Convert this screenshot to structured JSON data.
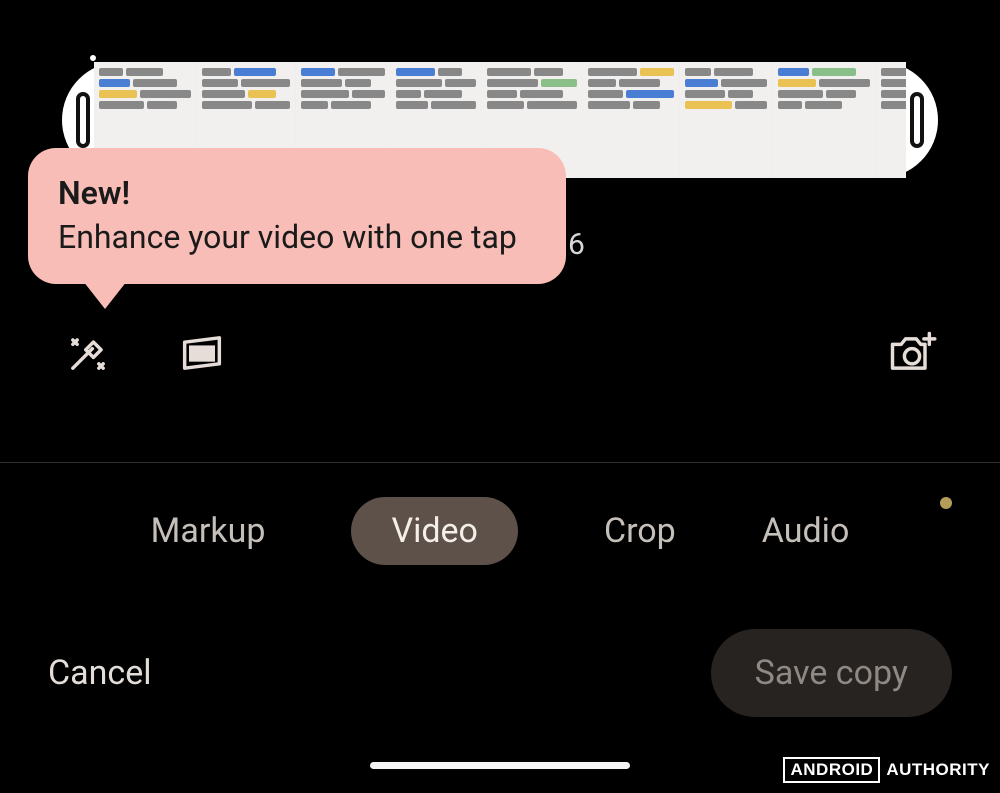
{
  "timeline": {
    "frames": [
      {
        "palette": [
          "d",
          "d",
          "b",
          "d",
          "y",
          "d",
          "d",
          "d"
        ]
      },
      {
        "palette": [
          "d",
          "b",
          "d",
          "d",
          "d",
          "y",
          "d",
          "d"
        ]
      },
      {
        "palette": [
          "b",
          "d",
          "d",
          "d",
          "d",
          "d",
          "d",
          "d"
        ]
      },
      {
        "palette": [
          "b",
          "d",
          "d",
          "d",
          "d",
          "d",
          "d",
          "d"
        ]
      },
      {
        "palette": [
          "d",
          "d",
          "d",
          "g",
          "d",
          "d",
          "d",
          "d"
        ]
      },
      {
        "palette": [
          "d",
          "y",
          "d",
          "d",
          "d",
          "b",
          "d",
          "d"
        ]
      },
      {
        "palette": [
          "d",
          "d",
          "b",
          "d",
          "d",
          "d",
          "y",
          "d"
        ]
      },
      {
        "palette": [
          "b",
          "g",
          "y",
          "d",
          "d",
          "d",
          "d",
          "d"
        ]
      },
      {
        "palette": [
          "d",
          "d",
          "d",
          "d",
          "d",
          "d",
          "d",
          "d"
        ]
      }
    ]
  },
  "tooltip": {
    "title": "New!",
    "body": "Enhance your video with one tap"
  },
  "counter_fragment": "6",
  "tools": {
    "enhance": "magic-wand",
    "frame": "frame",
    "export": "camera-export"
  },
  "tabs": {
    "items": [
      "Markup",
      "Video",
      "Crop",
      "Audio"
    ],
    "active_index": 1
  },
  "actions": {
    "cancel": "Cancel",
    "save": "Save copy"
  },
  "watermark": {
    "brand_box": "ANDROID",
    "brand_rest": "AUTHORITY"
  }
}
